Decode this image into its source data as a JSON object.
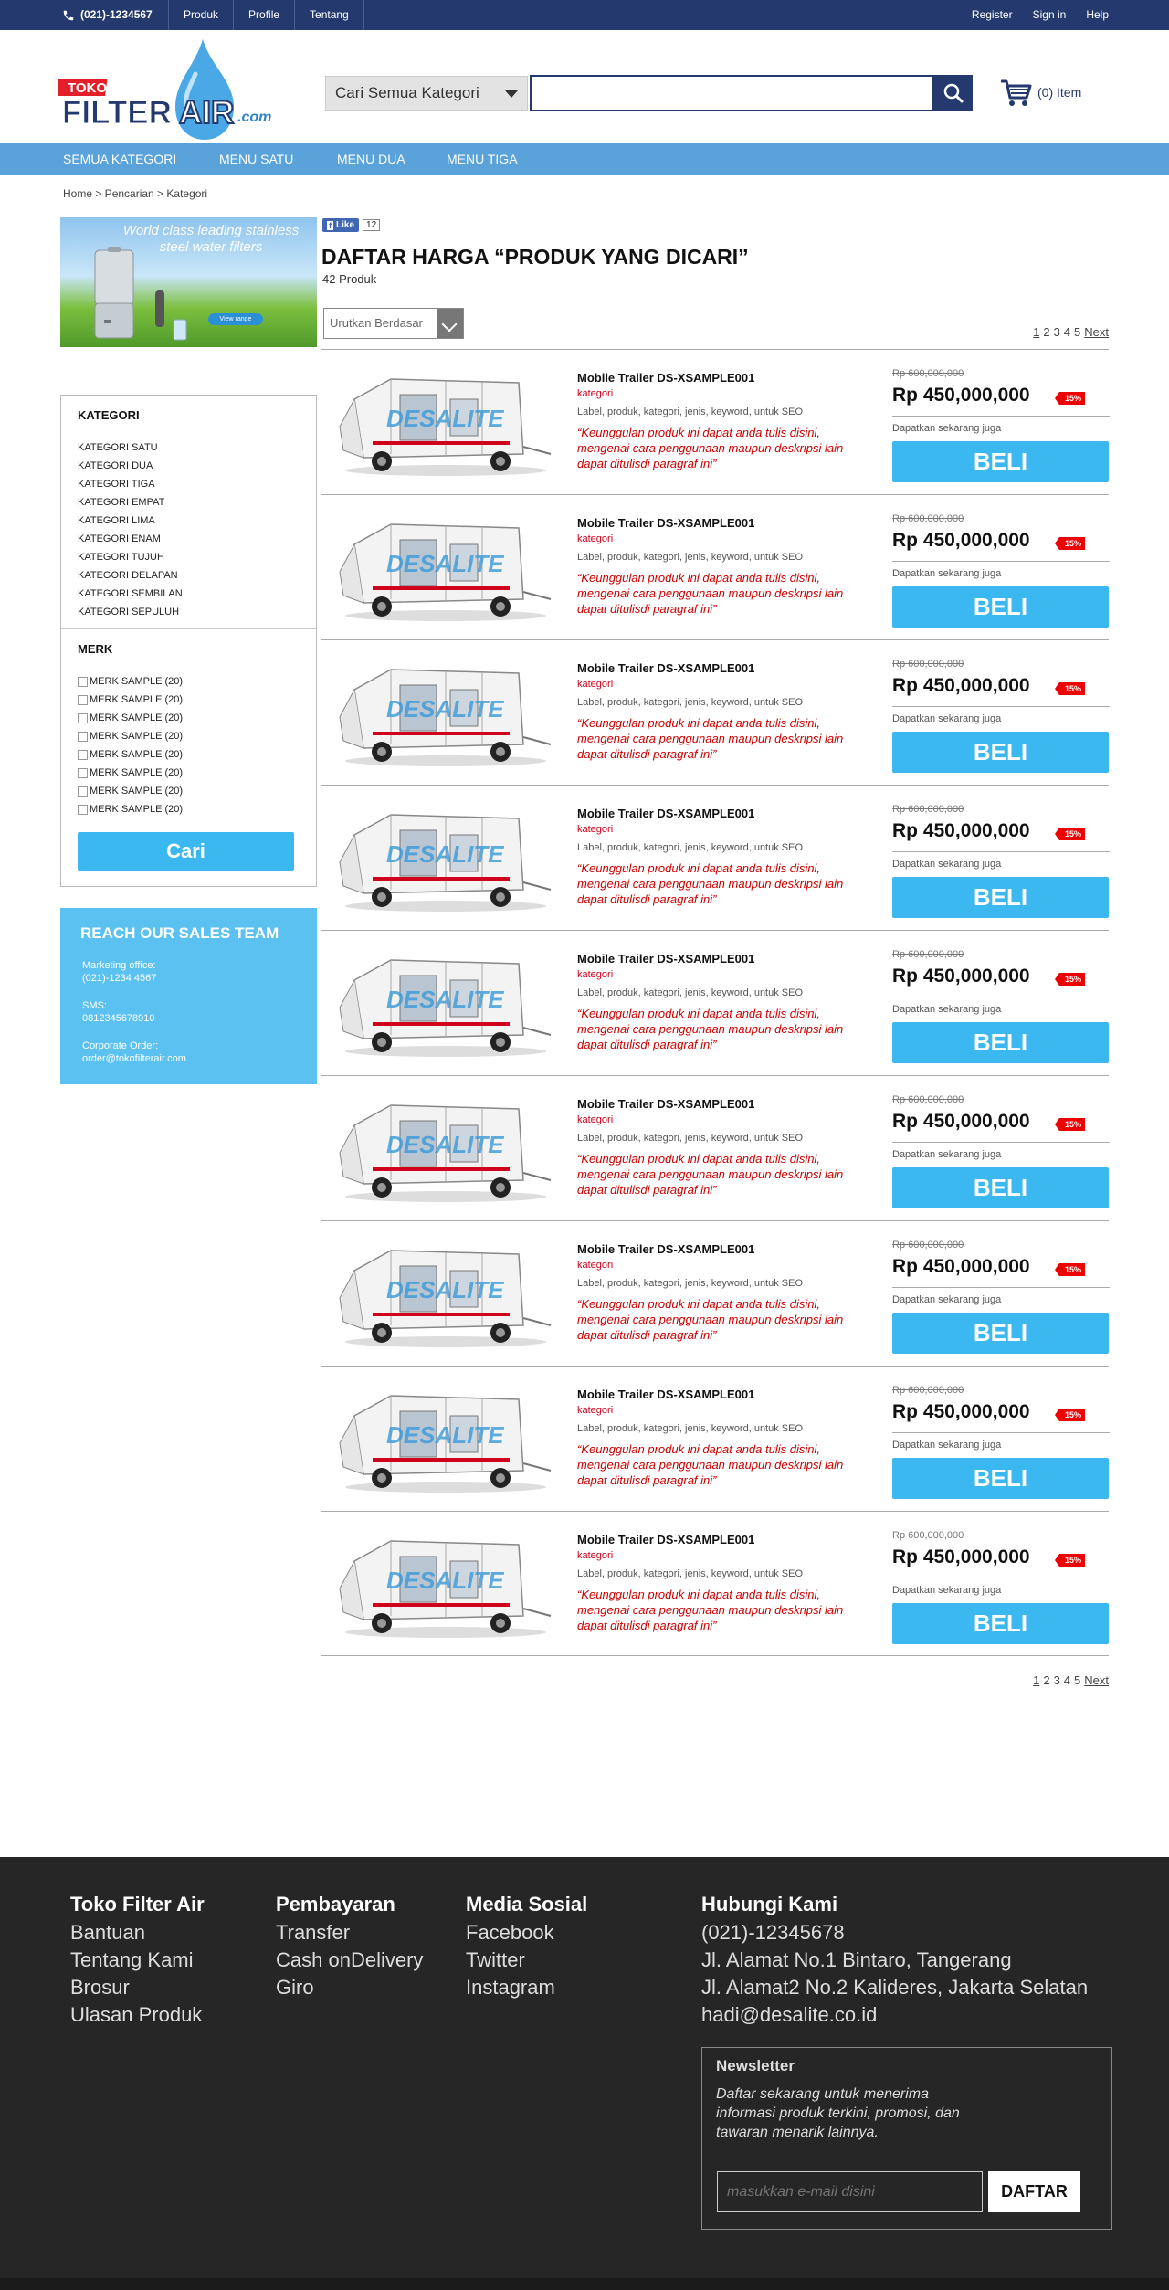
{
  "topbar": {
    "phone": "(021)-1234567",
    "nav": [
      "Produk",
      "Profile",
      "Tentang"
    ],
    "right": [
      "Register",
      "Sign in",
      "Help"
    ]
  },
  "logo": {
    "toko": "TOKO",
    "filter": "FILTER",
    "air": "AIR",
    "dotcom": ".com"
  },
  "search": {
    "category": "Cari Semua Kategori",
    "placeholder": "",
    "cart": "(0) Item"
  },
  "menu": [
    "SEMUA KATEGORI",
    "MENU SATU",
    "MENU DUA",
    "MENU TIGA"
  ],
  "breadcrumb": "Home > Pencarian > Kategori",
  "banner": {
    "text": "World class leading stainless steel water filters",
    "button": "View range"
  },
  "sidebar": {
    "kategori_title": "KATEGORI",
    "kategori": [
      "KATEGORI SATU",
      "KATEGORI DUA",
      "KATEGORI TIGA",
      "KATEGORI EMPAT",
      "KATEGORI LIMA",
      "KATEGORI ENAM",
      "KATEGORI TUJUH",
      "KATEGORI DELAPAN",
      "KATEGORI SEMBILAN",
      "KATEGORI SEPULUH"
    ],
    "merk_title": "MERK",
    "merk": [
      "MERK SAMPLE (20)",
      "MERK SAMPLE (20)",
      "MERK SAMPLE (20)",
      "MERK SAMPLE (20)",
      "MERK SAMPLE (20)",
      "MERK SAMPLE (20)",
      "MERK SAMPLE (20)",
      "MERK SAMPLE (20)"
    ],
    "cari": "Cari"
  },
  "sales": {
    "title": "REACH OUR SALES TEAM",
    "marketing_label": "Marketing office:",
    "marketing": "(021)-1234 4567",
    "sms_label": "SMS:",
    "sms": "0812345678910",
    "corporate_label": "Corporate Order:",
    "corporate": "order@tokofilterair.com"
  },
  "social": {
    "like": "Like",
    "count": "12"
  },
  "listing": {
    "title": "DAFTAR HARGA “PRODUK YANG DICARI”",
    "count": "42 Produk",
    "sort": "Urutkan Berdasar",
    "pages": [
      "1",
      "2",
      "3",
      "4",
      "5"
    ],
    "next": "Next"
  },
  "products": [
    {
      "name": "Mobile Trailer DS-XSAMPLE001",
      "cat": "kategori",
      "label": "Label, produk, kategori, jenis, keyword, untuk SEO",
      "desc": "“Keunggulan produk ini dapat anda tulis disini, mengenai cara penggunaan maupun deskripsi lain dapat ditulisdi paragraf ini”",
      "old": "Rp 600,000,000",
      "price": "Rp 450,000,000",
      "disc": "15%",
      "get": "Dapatkan sekarang juga",
      "buy": "BELI"
    },
    {
      "name": "Mobile Trailer DS-XSAMPLE001",
      "cat": "kategori",
      "label": "Label, produk, kategori, jenis, keyword, untuk SEO",
      "desc": "“Keunggulan produk ini dapat anda tulis disini, mengenai cara penggunaan maupun deskripsi lain dapat ditulisdi paragraf ini”",
      "old": "Rp 600,000,000",
      "price": "Rp 450,000,000",
      "disc": "15%",
      "get": "Dapatkan sekarang juga",
      "buy": "BELI"
    },
    {
      "name": "Mobile Trailer DS-XSAMPLE001",
      "cat": "kategori",
      "label": "Label, produk, kategori, jenis, keyword, untuk SEO",
      "desc": "“Keunggulan produk ini dapat anda tulis disini, mengenai cara penggunaan maupun deskripsi lain dapat ditulisdi paragraf ini”",
      "old": "Rp 600,000,000",
      "price": "Rp 450,000,000",
      "disc": "15%",
      "get": "Dapatkan sekarang juga",
      "buy": "BELI"
    },
    {
      "name": "Mobile Trailer DS-XSAMPLE001",
      "cat": "kategori",
      "label": "Label, produk, kategori, jenis, keyword, untuk SEO",
      "desc": "“Keunggulan produk ini dapat anda tulis disini, mengenai cara penggunaan maupun deskripsi lain dapat ditulisdi paragraf ini”",
      "old": "Rp 600,000,000",
      "price": "Rp 450,000,000",
      "disc": "15%",
      "get": "Dapatkan sekarang juga",
      "buy": "BELI"
    },
    {
      "name": "Mobile Trailer DS-XSAMPLE001",
      "cat": "kategori",
      "label": "Label, produk, kategori, jenis, keyword, untuk SEO",
      "desc": "“Keunggulan produk ini dapat anda tulis disini, mengenai cara penggunaan maupun deskripsi lain dapat ditulisdi paragraf ini”",
      "old": "Rp 600,000,000",
      "price": "Rp 450,000,000",
      "disc": "15%",
      "get": "Dapatkan sekarang juga",
      "buy": "BELI"
    },
    {
      "name": "Mobile Trailer DS-XSAMPLE001",
      "cat": "kategori",
      "label": "Label, produk, kategori, jenis, keyword, untuk SEO",
      "desc": "“Keunggulan produk ini dapat anda tulis disini, mengenai cara penggunaan maupun deskripsi lain dapat ditulisdi paragraf ini”",
      "old": "Rp 600,000,000",
      "price": "Rp 450,000,000",
      "disc": "15%",
      "get": "Dapatkan sekarang juga",
      "buy": "BELI"
    },
    {
      "name": "Mobile Trailer DS-XSAMPLE001",
      "cat": "kategori",
      "label": "Label, produk, kategori, jenis, keyword, untuk SEO",
      "desc": "“Keunggulan produk ini dapat anda tulis disini, mengenai cara penggunaan maupun deskripsi lain dapat ditulisdi paragraf ini”",
      "old": "Rp 600,000,000",
      "price": "Rp 450,000,000",
      "disc": "15%",
      "get": "Dapatkan sekarang juga",
      "buy": "BELI"
    },
    {
      "name": "Mobile Trailer DS-XSAMPLE001",
      "cat": "kategori",
      "label": "Label, produk, kategori, jenis, keyword, untuk SEO",
      "desc": "“Keunggulan produk ini dapat anda tulis disini, mengenai cara penggunaan maupun deskripsi lain dapat ditulisdi paragraf ini”",
      "old": "Rp 600,000,000",
      "price": "Rp 450,000,000",
      "disc": "15%",
      "get": "Dapatkan sekarang juga",
      "buy": "BELI"
    },
    {
      "name": "Mobile Trailer DS-XSAMPLE001",
      "cat": "kategori",
      "label": "Label, produk, kategori, jenis, keyword, untuk SEO",
      "desc": "“Keunggulan produk ini dapat anda tulis disini, mengenai cara penggunaan maupun deskripsi lain dapat ditulisdi paragraf ini”",
      "old": "Rp 600,000,000",
      "price": "Rp 450,000,000",
      "disc": "15%",
      "get": "Dapatkan sekarang juga",
      "buy": "BELI"
    }
  ],
  "footer": {
    "col1": {
      "title": "Toko Filter Air",
      "items": [
        "Bantuan",
        "Tentang Kami",
        "Brosur",
        "Ulasan Produk"
      ]
    },
    "col2": {
      "title": "Pembayaran",
      "items": [
        "Transfer",
        "Cash onDelivery",
        "Giro"
      ]
    },
    "col3": {
      "title": "Media Sosial",
      "items": [
        "Facebook",
        "Twitter",
        "Instagram"
      ]
    },
    "col4": {
      "title": "Hubungi Kami",
      "items": [
        "(021)-12345678",
        "Jl. Alamat No.1 Bintaro, Tangerang",
        "Jl. Alamat2 No.2 Kalideres, Jakarta Selatan",
        "hadi@desalite.co.id"
      ]
    },
    "newsletter": {
      "title": "Newsletter",
      "desc": "Daftar sekarang untuk menerima informasi produk terkini, promosi, dan tawaran menarik lainnya.",
      "placeholder": "masukkan e-mail disini",
      "button": "DAFTAR"
    }
  },
  "colors": {
    "navy": "#243a6e",
    "menu": "#5aa2da",
    "accent": "#3bb8ef",
    "sale": "#e00000",
    "footer": "#262626"
  }
}
